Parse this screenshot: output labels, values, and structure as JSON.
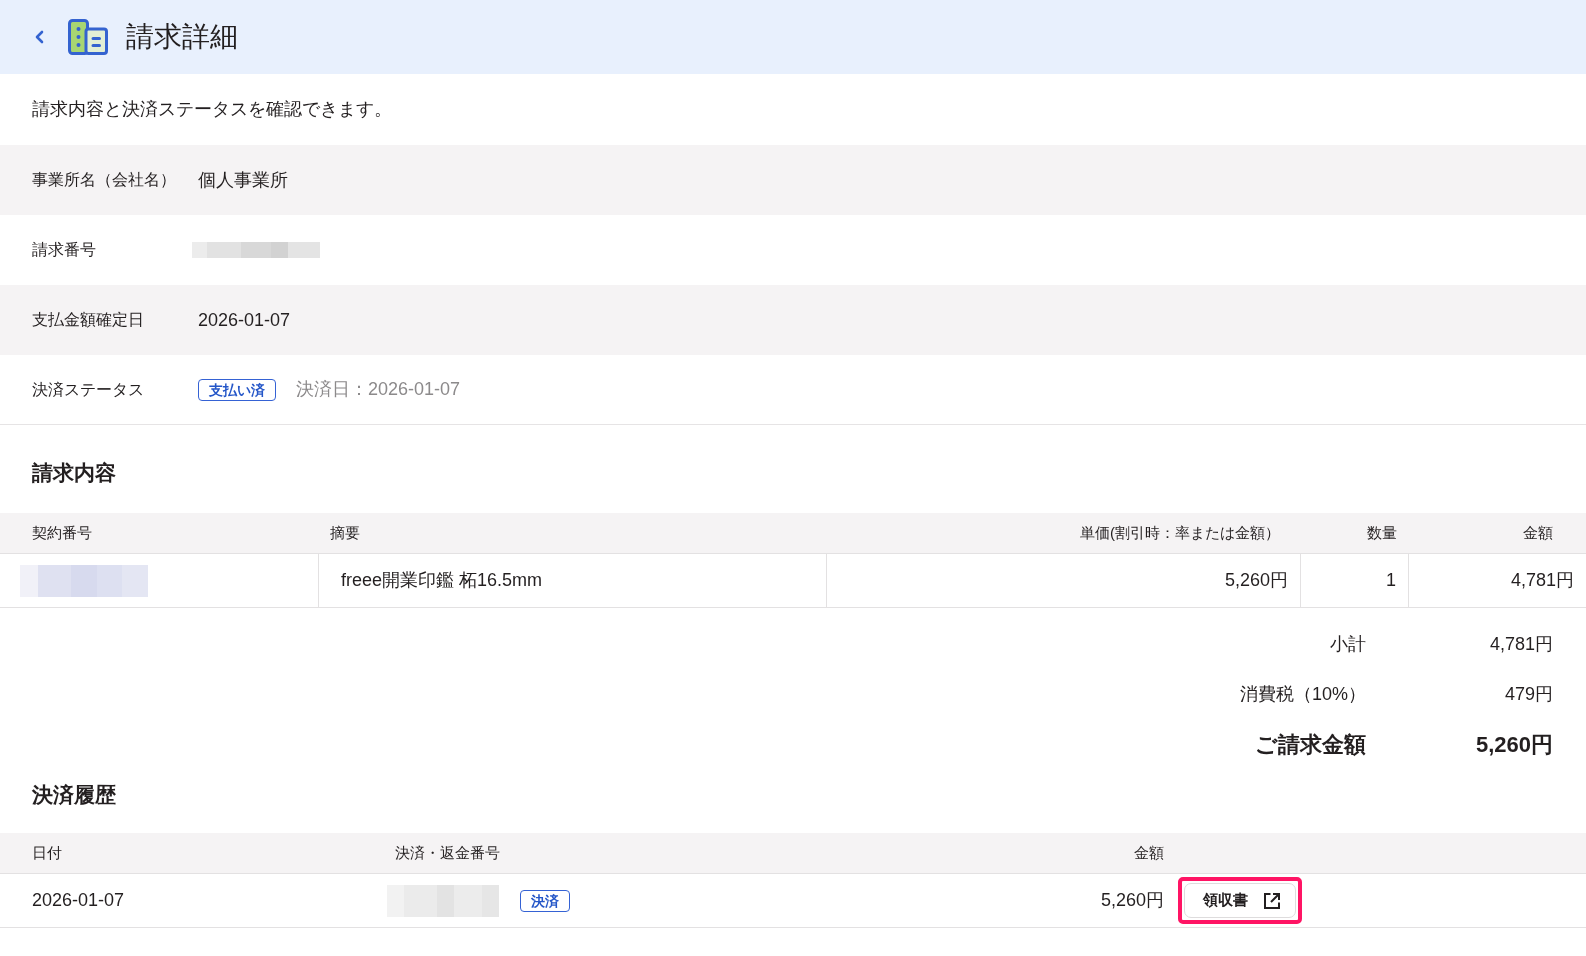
{
  "header": {
    "title": "請求詳細"
  },
  "description": "請求内容と決済ステータスを確認できます。",
  "details": [
    {
      "kind": "text",
      "label": "事業所名（会社名）",
      "value": "個人事業所"
    },
    {
      "kind": "redacted",
      "label": "請求番号"
    },
    {
      "kind": "text",
      "label": "支払金額確定日",
      "value": "2026-01-07"
    },
    {
      "kind": "status",
      "label": "決済ステータス",
      "badge": "支払い済",
      "note": "決済日：2026-01-07"
    }
  ],
  "invoice": {
    "title": "請求内容",
    "columns": [
      "契約番号",
      "摘要",
      "単価(割引時：率または金額）",
      "数量",
      "金額"
    ],
    "rows": [
      {
        "contract_redacted": true,
        "description": "freee開業印鑑 柘16.5mm",
        "unit_price": "5,260円",
        "quantity": "1",
        "amount": "4,781円"
      }
    ],
    "totals": [
      {
        "kind": "normal",
        "label": "小計",
        "value": "4,781円"
      },
      {
        "kind": "normal",
        "label": "消費税（10%）",
        "value": "479円"
      },
      {
        "kind": "grand",
        "label": "ご請求金額",
        "value": "5,260円"
      }
    ]
  },
  "history": {
    "title": "決済履歴",
    "columns": [
      "日付",
      "決済・返金番号",
      "金額"
    ],
    "rows": [
      {
        "date": "2026-01-07",
        "number_redacted": true,
        "badge": "決済",
        "amount": "5,260円",
        "receipt_button": {
          "label": "領収書",
          "highlighted": true
        }
      }
    ]
  }
}
